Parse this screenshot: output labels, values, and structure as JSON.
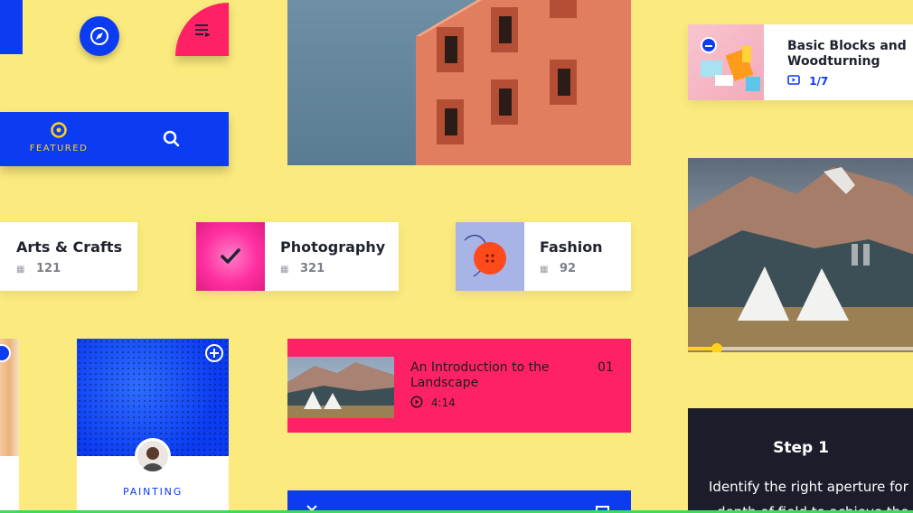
{
  "featured_nav": {
    "label": "FEATURED"
  },
  "categories": [
    {
      "title": "Arts & Crafts",
      "count": "121"
    },
    {
      "title": "Photography",
      "count": "321"
    },
    {
      "title": "Fashion",
      "count": "92"
    }
  ],
  "course": {
    "title": "Basic Blocks and Woodturning",
    "progress": "1/7"
  },
  "lesson": {
    "title": "An Introduction to the Landscape",
    "number": "01",
    "duration": "4:14"
  },
  "painting": {
    "label": "PAINTING"
  },
  "step": {
    "title": "Step 1",
    "text_line1": "Identify the right aperture for",
    "text_line2": "depth of field to achieve the"
  },
  "video": {
    "progress_fraction": 0.04
  },
  "colors": {
    "bg": "#fbea7e",
    "blue": "#0b3cf2",
    "pink": "#ff2166",
    "orange": "#ff4a1c",
    "dark": "#1c1d2b"
  }
}
